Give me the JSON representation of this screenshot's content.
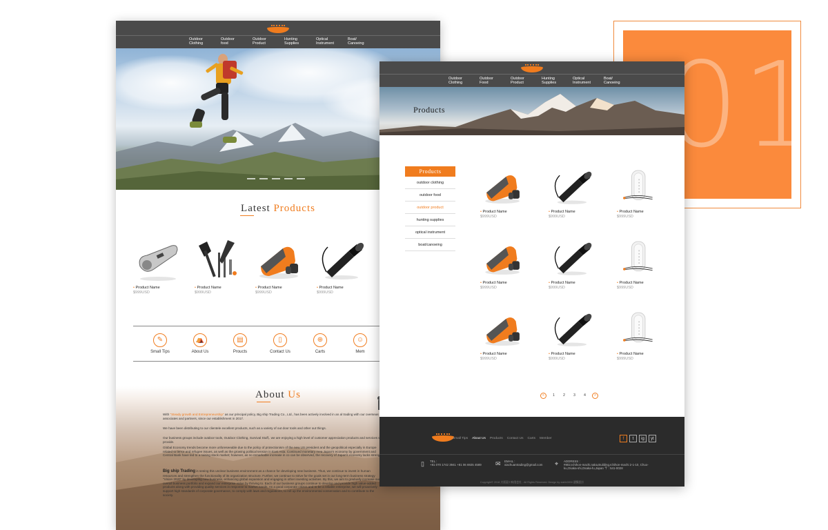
{
  "deco": {
    "number": "01",
    "colors": {
      "accent": "#fb8a3c"
    }
  },
  "nav_items": [
    "Outdoor\nClothing",
    "Outdoor\nfood",
    "Outdoor\nProduct",
    "Hunting\nSupplies",
    "Optical\nInstrument",
    "Boat/\nCanoeing"
  ],
  "nav_items_p2": [
    "Outdoor\nClothing",
    "Outdoor\nFood",
    "Outdoor\nProduct",
    "Hunting\nSupplies",
    "Optical\nInstrument",
    "Boat/\nCanoeing"
  ],
  "home": {
    "latest_title_plain": "Latest",
    "latest_title_accent": "Products",
    "products": [
      {
        "name": "Product Name",
        "price": "$999USD",
        "icon": "whistle-icon"
      },
      {
        "name": "Product Name",
        "price": "$999USD",
        "icon": "shovel-kit-icon"
      },
      {
        "name": "Product Name",
        "price": "$999USD",
        "icon": "sleeping-bag-icon"
      },
      {
        "name": "Product Name",
        "price": "$999USD",
        "icon": "flashlight-icon"
      }
    ],
    "services": [
      {
        "label": "Small Tips",
        "icon": "tips-icon"
      },
      {
        "label": "About Us",
        "icon": "tent-icon"
      },
      {
        "label": "Proucts",
        "icon": "document-icon"
      },
      {
        "label": "Contact Us",
        "icon": "phone-icon"
      },
      {
        "label": "Carts",
        "icon": "cart-icon"
      },
      {
        "label": "Mem",
        "icon": "member-icon"
      }
    ],
    "about_title_plain": "About",
    "about_title_accent": "Us",
    "about_intro_prefix": "With",
    "about_intro_highlight": "\"Steady growth and Entrepreneurship\"",
    "about_intro_rest": "as our principal policy, Big ship Trading Co., Ltd., has been actively involved in an al trading with our overseas associates and partners, since our establishment in 2017.",
    "about_p2": "We have been distributing to our clientele excellent products, such as a variety of out door tools and other out things.",
    "about_p3": "Our business groups include outdoor tools, Outdoor Clothing, Survival Stuff,. we are enjoying a high level of customer appreciation products and services we provide.",
    "about_p4": "Global Economy trends become more unforeseeable due to the policy of protectionism of the new US president and the geopolitical especially in Europe related to terror and refugee issues, as well as the growing political tension in East Asia. Continued monetary mea Japan's economy by government and Central Bank have led to a raising stock market; however, as no remarkable increase in co can be observed, the recovery of Japan's economy lacks strength.",
    "about_p5_bold": "Big ship Trading",
    "about_p5_rest": "is seeing this unclear business environment as a chance for developing new business. Thus, we continue to invest in human resources and strengthen the functionality of its organization structure. Further, we continue to strive for the goals set in our long-term business strategy \"Vision 2020\" by developing new business, enhancing global expansion and engaging in other investing activities. By this, we aim to gradually increase our overall business portfolio and expand our enterprise value by thriving to. Each of our business groups continue to develop and provide high value-added products along with providing quality services in response to market needs. As a good corporate citizen and to be a reliable enterprise, we will proactively support high standards of corporate governance, to comply with laws and regulations, to roll up the environmental conservation and to contribute to the society."
  },
  "products_page": {
    "hero_title": "Products",
    "sidebar_title": "Products",
    "categories": [
      "outdoor clothing",
      "outdoor food",
      "outdoor product",
      "hunting supplies",
      "optical instrument",
      "boat/canoeing"
    ],
    "active_category": "outdoor product",
    "grid": [
      {
        "name": "Product Name",
        "price": "$999USD",
        "icon": "sleeping-bag-icon"
      },
      {
        "name": "Product Name",
        "price": "$999USD",
        "icon": "flashlight-icon"
      },
      {
        "name": "Product Name",
        "price": "$999USD",
        "icon": "lantern-icon"
      },
      {
        "name": "Product Name",
        "price": "$999USD",
        "icon": "sleeping-bag-icon"
      },
      {
        "name": "Product Name",
        "price": "$999USD",
        "icon": "flashlight-icon"
      },
      {
        "name": "Product Name",
        "price": "$999USD",
        "icon": "lantern-icon"
      },
      {
        "name": "Product Name",
        "price": "$999USD",
        "icon": "sleeping-bag-icon"
      },
      {
        "name": "Product Name",
        "price": "$999USD",
        "icon": "flashlight-icon"
      },
      {
        "name": "Product Name",
        "price": "$999USD",
        "icon": "lantern-icon"
      }
    ],
    "pagination": {
      "prev": "<",
      "pages": [
        "1",
        "2",
        "3",
        "4"
      ],
      "next": ">"
    },
    "footer": {
      "nav": [
        "Small Tips",
        "About Us",
        "Products",
        "Contact Us",
        "Carts",
        "Member"
      ],
      "active_nav": "About Us",
      "social": [
        "f",
        "t",
        "ig",
        "yt"
      ],
      "tel_label": "TEL :",
      "tel_value": "+81 070 1742 3941   +81 06 6925 4589",
      "email_label": "EMAIL :",
      "email_value": "xiachuantrading@gmail.com",
      "address_label": "ADDRESS :",
      "address_value": "#802,Ichihon-machi,naka,Building,Ichihon-machi 2-1-10, Chuo-ku,Osaka-shi,Osaka-fu,Japan  〒 : 541-0028",
      "copyright": "Copyright© 2018 大阪夏川有限会社 . All Rights Reserved. Design by xiahh0000 建築設計"
    }
  }
}
